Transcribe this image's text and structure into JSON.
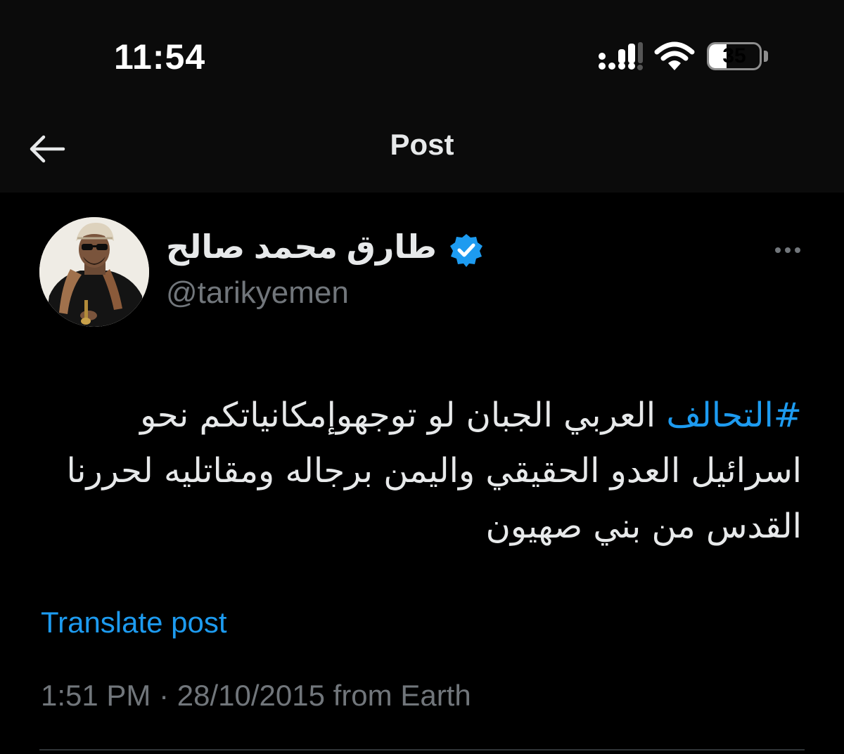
{
  "status_bar": {
    "time": "11:54",
    "battery_level": "35",
    "battery_fraction": 0.35
  },
  "header": {
    "title": "Post",
    "back_icon": "arrow-left-icon"
  },
  "post": {
    "author": {
      "display_name": "طارق محمد صالح",
      "handle": "@tarikyemen",
      "verified": true,
      "verified_color": "#1d9bf0"
    },
    "hashtag": "#التحالف",
    "body": " العربي الجبان لو توجهوإمكانياتكم نحو اسرائيل العدو الحقيقي واليمن برجاله ومقاتليه لحررنا القدس من بني صهيون",
    "translate_label": "Translate post",
    "time": "1:51 PM",
    "separator": "·",
    "date": "28/10/2015",
    "source": "from Earth"
  },
  "colors": {
    "accent": "#1d9bf0",
    "secondary_text": "#71767b",
    "background": "#000000"
  }
}
